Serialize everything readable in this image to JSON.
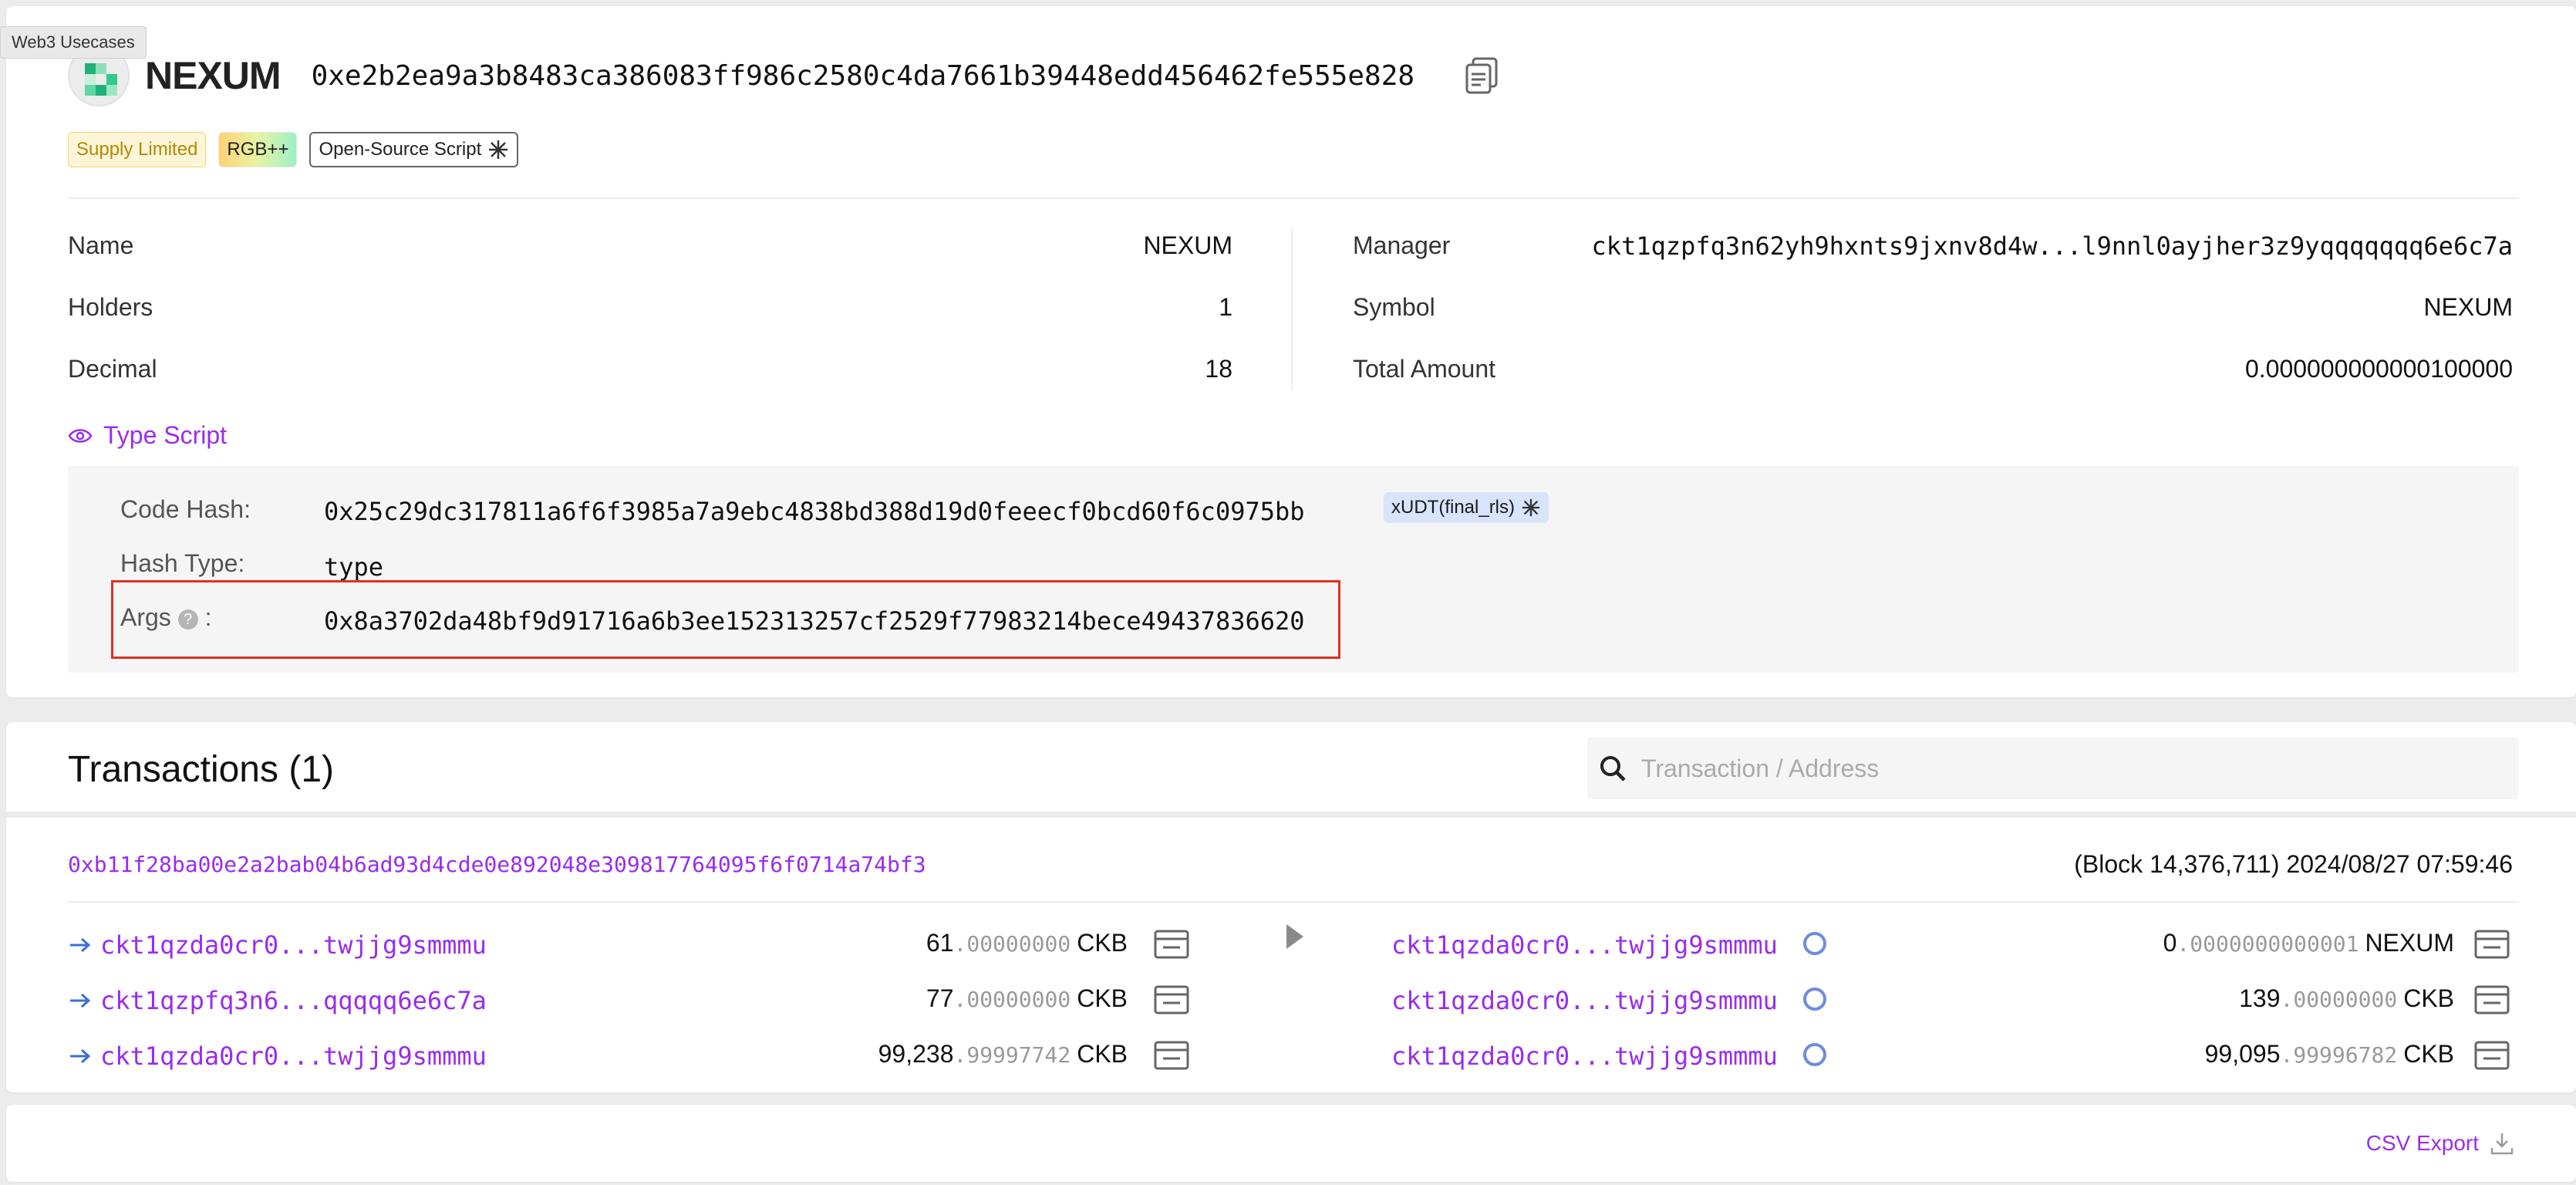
{
  "tooltip": "Web3 Usecases",
  "token": {
    "name": "NEXUM",
    "hash": "0xe2b2ea9a3b8483ca386083ff986c2580c4da7661b39448edd456462fe555e828"
  },
  "tags": {
    "supply": "Supply Limited",
    "rgb": "RGB++",
    "open_source": "Open-Source Script"
  },
  "info": {
    "name_label": "Name",
    "name_value": "NEXUM",
    "holders_label": "Holders",
    "holders_value": "1",
    "decimal_label": "Decimal",
    "decimal_value": "18",
    "manager_label": "Manager",
    "manager_value": "ckt1qzpfq3n62yh9hxnts9jxnv8d4w...l9nnl0ayjher3z9yqqqqqqq6e6c7a",
    "symbol_label": "Symbol",
    "symbol_value": "NEXUM",
    "total_label": "Total Amount",
    "total_value": "0.000000000000100000"
  },
  "type_script": {
    "label": "Type Script",
    "code_hash_label": "Code Hash:",
    "code_hash_value": "0x25c29dc317811a6f6f3985a7a9ebc4838bd388d19d0feeecf0bcd60f6c0975bb",
    "code_hash_tag": "xUDT(final_rls)",
    "hash_type_label": "Hash Type:",
    "hash_type_value": "type",
    "args_label": "Args",
    "args_colon": ":",
    "args_help": "?",
    "args_value": "0x8a3702da48bf9d91716a6b3ee152313257cf2529f77983214bece49437836620"
  },
  "transactions": {
    "title": "Transactions (1)",
    "search_placeholder": "Transaction / Address",
    "tx_hash": "0xb11f28ba00e2a2bab04b6ad93d4cde0e892048e309817764095f6f0714a74bf3",
    "block_info": "(Block 14,376,711) 2024/08/27 07:59:46",
    "inputs": [
      {
        "address": "ckt1qzda0cr0...twjjg9smmmu",
        "int": "61",
        "dec": ".00000000",
        "unit": "CKB"
      },
      {
        "address": "ckt1qzpfq3n6...qqqqq6e6c7a",
        "int": "77",
        "dec": ".00000000",
        "unit": "CKB"
      },
      {
        "address": "ckt1qzda0cr0...twjjg9smmmu",
        "int": "99,238",
        "dec": ".99997742",
        "unit": "CKB"
      }
    ],
    "outputs": [
      {
        "address": "ckt1qzda0cr0...twjjg9smmmu",
        "int": "0",
        "dec": ".0000000000001",
        "unit": "NEXUM"
      },
      {
        "address": "ckt1qzda0cr0...twjjg9smmmu",
        "int": "139",
        "dec": ".00000000",
        "unit": "CKB"
      },
      {
        "address": "ckt1qzda0cr0...twjjg9smmmu",
        "int": "99,095",
        "dec": ".99996782",
        "unit": "CKB"
      }
    ]
  },
  "csv_export": "CSV Export",
  "colors": {
    "accent": "#9a2cec",
    "highlight_border": "#e0311f",
    "output_circle": "#6e8be0"
  }
}
